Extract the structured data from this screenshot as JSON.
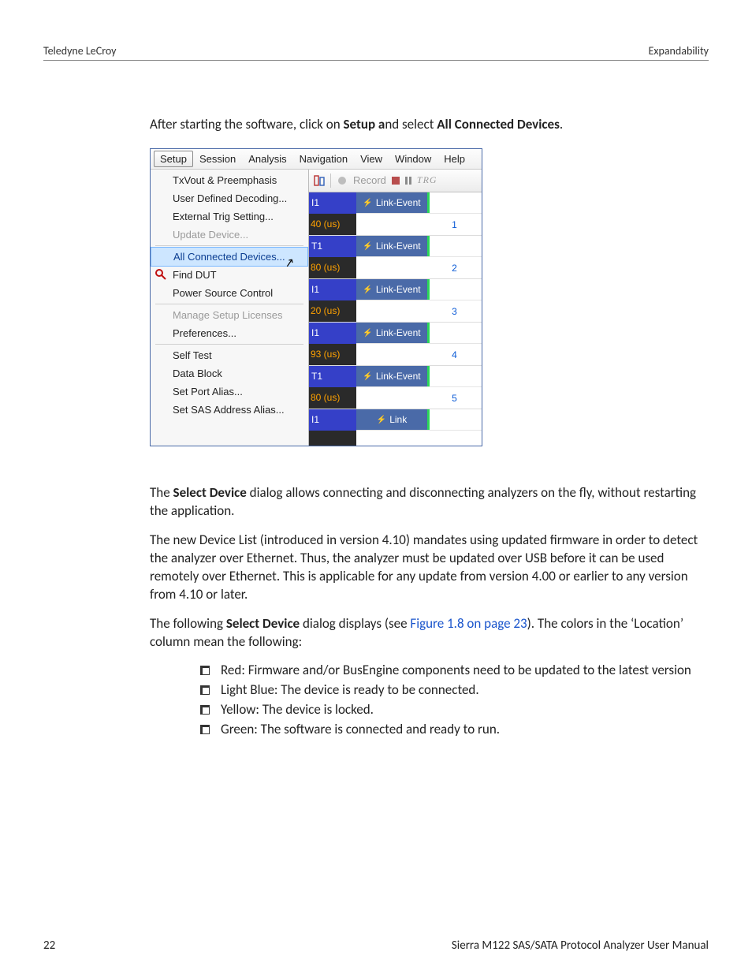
{
  "header": {
    "left": "Teledyne LeCroy",
    "right": "Expandability"
  },
  "intro": {
    "prefix": "After starting the software, click on ",
    "bold1": "Setup a",
    "mid": "nd select ",
    "bold2": "All Connected Devices",
    "suffix": "."
  },
  "menubar": [
    "Setup",
    "Session",
    "Analysis",
    "Navigation",
    "View",
    "Window",
    "Help"
  ],
  "setup_menu": [
    {
      "label": "TxVout & Preemphasis",
      "kind": "item"
    },
    {
      "label": "User Defined Decoding...",
      "kind": "item"
    },
    {
      "label": "External Trig Setting...",
      "kind": "item"
    },
    {
      "label": "Update Device...",
      "kind": "disabled"
    },
    {
      "kind": "sep"
    },
    {
      "label": "All Connected Devices...",
      "kind": "hover"
    },
    {
      "label": "Find DUT",
      "kind": "item",
      "icon": "find"
    },
    {
      "label": "Power Source Control",
      "kind": "item"
    },
    {
      "kind": "sep"
    },
    {
      "label": "Manage Setup Licenses",
      "kind": "disabled"
    },
    {
      "label": "Preferences...",
      "kind": "item"
    },
    {
      "kind": "sep"
    },
    {
      "label": "Self Test",
      "kind": "item"
    },
    {
      "label": "Data Block",
      "kind": "item"
    },
    {
      "label": "Set Port Alias...",
      "kind": "item"
    },
    {
      "label": "Set SAS Address Alias...",
      "kind": "item"
    }
  ],
  "toolbar": {
    "record": "Record"
  },
  "trace_rows": [
    {
      "port": "I1",
      "time": "40 (us)",
      "event": "Link-Event",
      "idx": "1"
    },
    {
      "port": "T1",
      "time": "80 (us)",
      "event": "Link-Event",
      "idx": "2"
    },
    {
      "port": "I1",
      "time": "20 (us)",
      "event": "Link-Event",
      "idx": "3"
    },
    {
      "port": "I1",
      "time": "93 (us)",
      "event": "Link-Event",
      "idx": "4"
    },
    {
      "port": "T1",
      "time": "80 (us)",
      "event": "Link-Event",
      "idx": "5"
    },
    {
      "port": "I1",
      "time": "",
      "event": "Link",
      "idx": ""
    }
  ],
  "para_select": {
    "prefix": "The ",
    "bold": "Select Device",
    "rest": " dialog allows connecting and disconnecting analyzers on the fly, without restarting the application."
  },
  "para_fw": "The new Device List (introduced in version 4.10) mandates using updated firmware in order to detect the analyzer over Ethernet. Thus, the analyzer must be updated over USB before it can be used remotely over Ethernet. This is applicable for any update from version 4.00 or earlier to any version from 4.10 or later.",
  "para_colors": {
    "prefix": "The following ",
    "bold": "Select Device",
    "mid": " dialog displays (see ",
    "link": "Figure 1.8 on page 23",
    "rest": "). The colors in the ‘Location’ column mean the following:"
  },
  "bullets": [
    "Red: Firmware and/or BusEngine components need to be updated to the latest version",
    "Light Blue: The device is ready to be connected.",
    "Yellow: The device is locked.",
    "Green: The software is connected and ready to run."
  ],
  "footer": {
    "page": "22",
    "title": "Sierra M122 SAS/SATA Protocol Analyzer User Manual"
  }
}
